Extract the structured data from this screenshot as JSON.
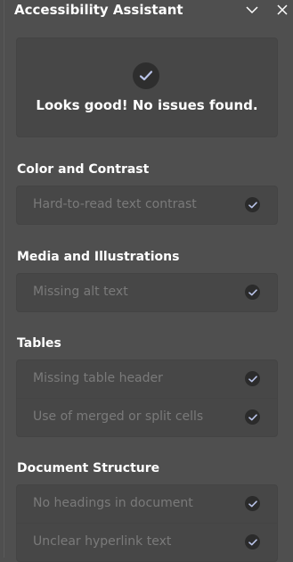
{
  "pane": {
    "title": "Accessibility Assistant",
    "icons": {
      "collapse": "chevron-down-icon",
      "close": "close-icon"
    }
  },
  "summary": {
    "icon": "check-circle-icon",
    "text": "Looks good! No issues found."
  },
  "sections": [
    {
      "title": "Color and Contrast",
      "items": [
        {
          "label": "Hard-to-read text contrast",
          "status": "passed"
        }
      ]
    },
    {
      "title": "Media and Illustrations",
      "items": [
        {
          "label": "Missing alt text",
          "status": "passed"
        }
      ]
    },
    {
      "title": "Tables",
      "items": [
        {
          "label": "Missing table header",
          "status": "passed"
        },
        {
          "label": "Use of merged or split cells",
          "status": "passed"
        }
      ]
    },
    {
      "title": "Document Structure",
      "items": [
        {
          "label": "No headings in document",
          "status": "passed"
        },
        {
          "label": "Unclear hyperlink text",
          "status": "passed"
        }
      ]
    }
  ],
  "colors": {
    "background": "#4f4f4f",
    "card": "#474747",
    "muted_text": "#7a7a7a",
    "check_fill": "#2b2b2b",
    "check_mark": "#b9c3e8"
  }
}
